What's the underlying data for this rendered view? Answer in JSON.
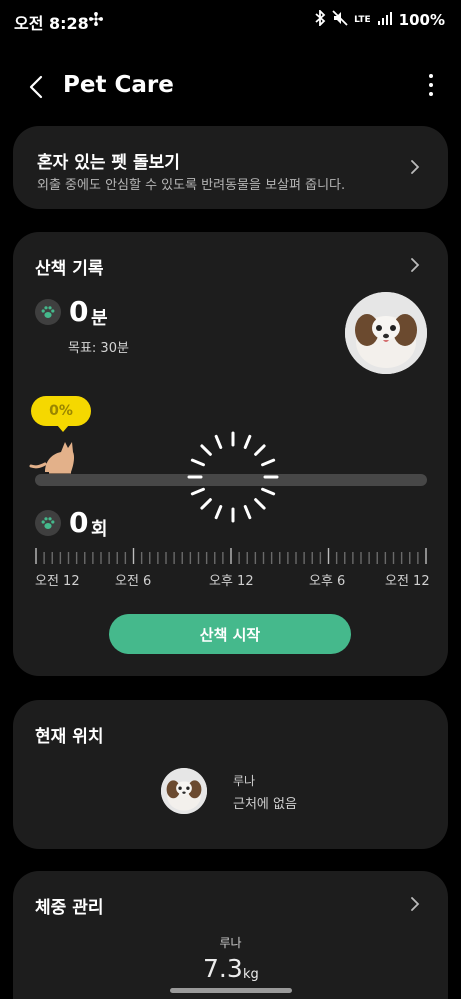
{
  "status_bar": {
    "time": "오전 8:28",
    "network": "LTE",
    "battery": "100%"
  },
  "app_bar": {
    "title": "Pet Care"
  },
  "pet_sitting_card": {
    "title": "혼자 있는 펫 돌보기",
    "subtitle": "외출 중에도 안심할 수 있도록 반려동물을 보살펴 줍니다."
  },
  "walk_card": {
    "title": "산책 기록",
    "minutes_value": "0",
    "minutes_unit": "분",
    "goal_text": "목표: 30분",
    "progress_label": "0%",
    "progress": 0,
    "count_value": "0",
    "count_unit": "회",
    "time_labels": [
      "오전 12",
      "오전 6",
      "오후 12",
      "오후 6",
      "오전 12"
    ],
    "start_button": "산책 시작"
  },
  "location_card": {
    "title": "현재 위치",
    "pet_name": "루나",
    "status": "근처에 없음"
  },
  "weight_card": {
    "title": "체중 관리",
    "pet_name": "루나",
    "weight_value": "7.3",
    "weight_unit": "kg"
  },
  "colors": {
    "accent": "#45b98c",
    "card": "#1d1d1d",
    "bubble": "#f5d800"
  }
}
